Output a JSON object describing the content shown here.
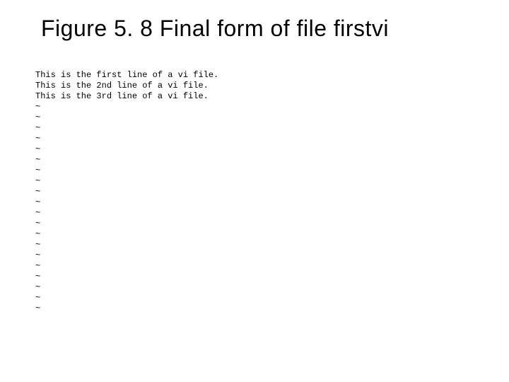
{
  "title": "Figure 5. 8  Final form of file firstvi",
  "terminal_lines": [
    "This is the first line of a vi file.",
    "This is the 2nd line of a vi file.",
    "This is the 3rd line of a vi file.",
    "~",
    "~",
    "~",
    "~",
    "~",
    "~",
    "~",
    "~",
    "~",
    "~",
    "~",
    "~",
    "~",
    "~",
    "~",
    "~",
    "~",
    "~",
    "~",
    "~"
  ]
}
